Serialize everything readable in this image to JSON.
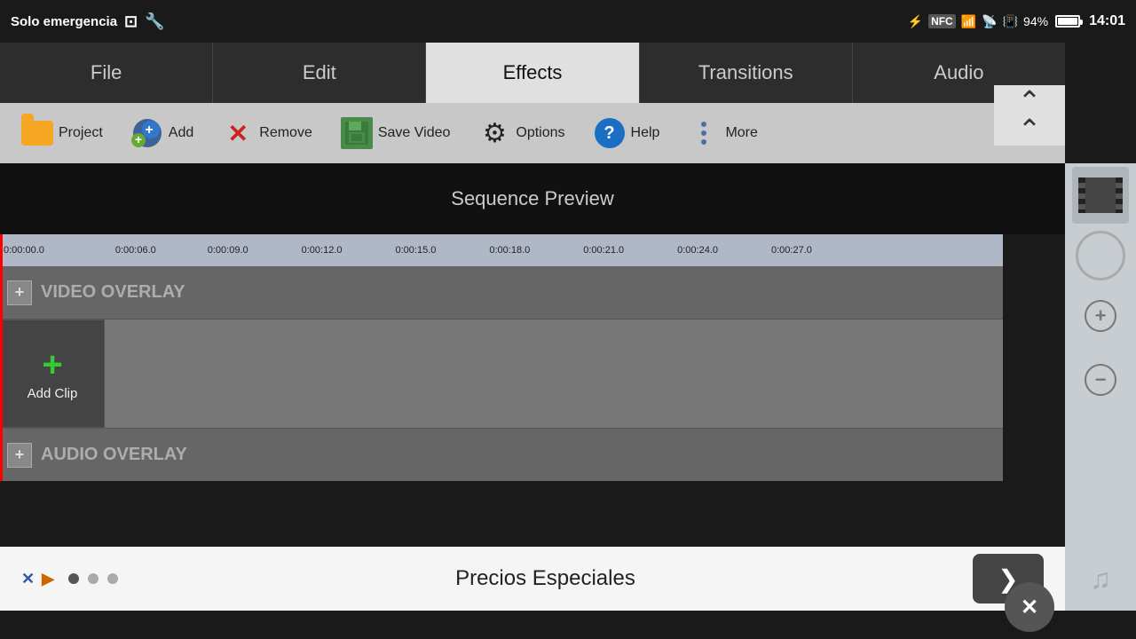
{
  "status_bar": {
    "app_name": "Solo emergencia",
    "bluetooth_icon": "bluetooth",
    "nfc_icon": "NFC",
    "signal_icon": "signal",
    "wifi_icon": "wifi",
    "battery_icon": "battery",
    "battery_percent": "94%",
    "time": "14:01"
  },
  "tabs": [
    {
      "id": "file",
      "label": "File",
      "active": false
    },
    {
      "id": "edit",
      "label": "Edit",
      "active": false
    },
    {
      "id": "effects",
      "label": "Effects",
      "active": true
    },
    {
      "id": "transitions",
      "label": "Transitions",
      "active": false
    },
    {
      "id": "audio",
      "label": "Audio",
      "active": false
    }
  ],
  "toolbar": {
    "project_label": "Project",
    "add_label": "Add",
    "remove_label": "Remove",
    "save_video_label": "Save Video",
    "options_label": "Options",
    "help_label": "Help",
    "more_label": "More"
  },
  "sequence_preview": {
    "label": "Sequence Preview"
  },
  "timeline": {
    "ruler_marks": [
      "0:00:00.0",
      "0:00:06.0",
      "0:00:09.0",
      "0:00:12.0",
      "0:00:15.0",
      "0:00:18.0",
      "0:00:21.0",
      "0:00:24.0",
      "0:00:27.0"
    ],
    "video_overlay_label": "VIDEO OVERLAY",
    "audio_overlay_label": "AUDIO OVERLAY",
    "add_clip_label": "Add Clip",
    "add_clip_plus": "+"
  },
  "ad_bar": {
    "text": "Precios Especiales",
    "next_arrow": "❯",
    "dots": [
      true,
      false,
      false
    ],
    "close_label": "✕"
  }
}
